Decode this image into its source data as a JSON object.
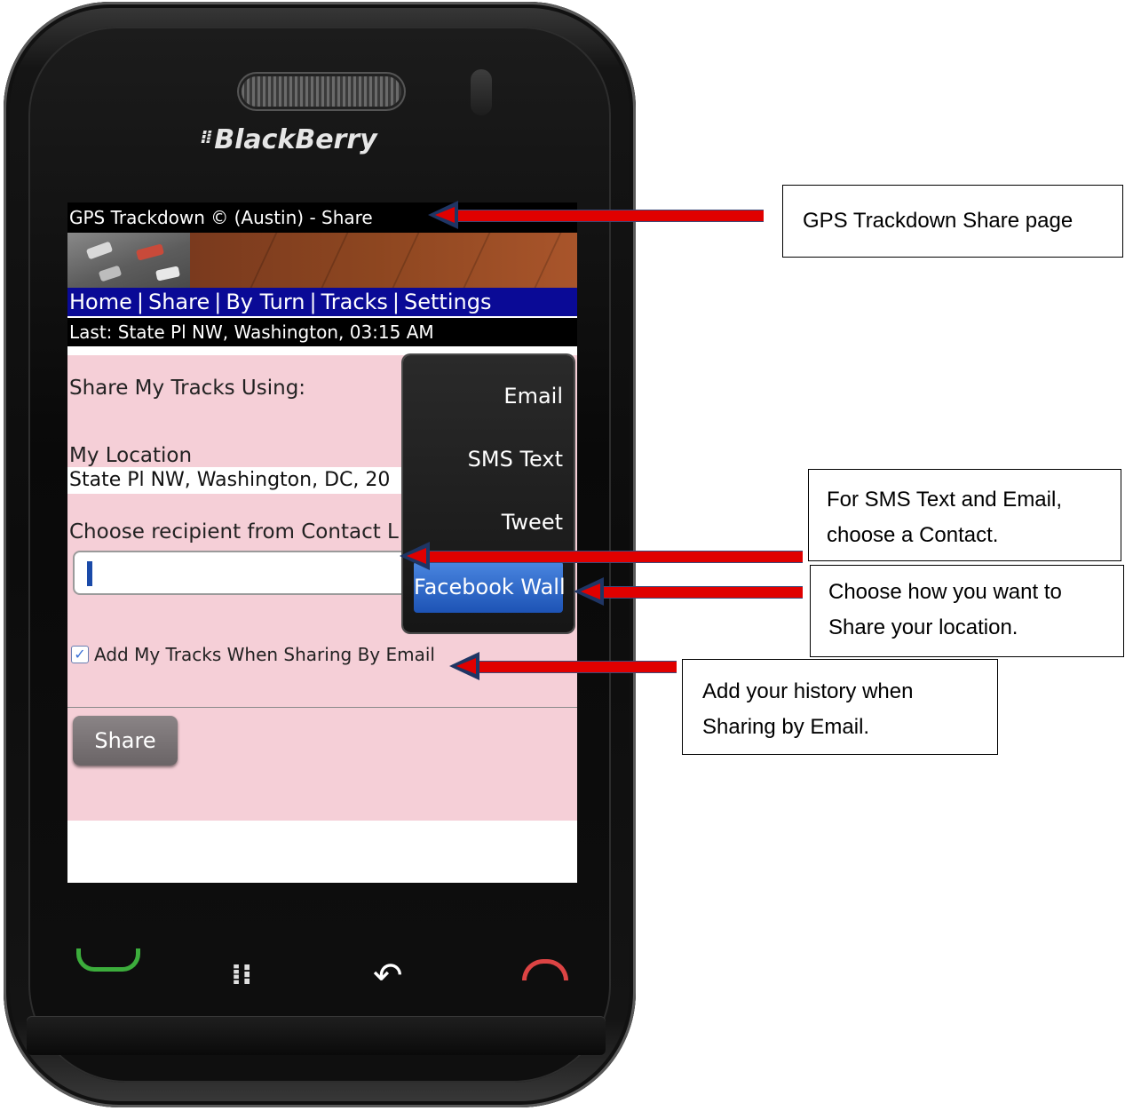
{
  "device": {
    "brand": "BlackBerry",
    "brand_dots": "⁝⁞"
  },
  "app": {
    "title": "GPS Trackdown © (Austin) - Share",
    "nav": [
      "Home",
      "Share",
      "By Turn",
      "Tracks",
      "Settings"
    ],
    "nav_separator": "|",
    "last_location": "Last: State Pl NW, Washington, 03:15 AM",
    "share_using_label": "Share My Tracks Using:",
    "my_location_label": "My Location",
    "my_location_value": "State Pl NW, Washington, DC, 20",
    "recipient_label": "Choose recipient from Contact L",
    "recipient_value": "",
    "add_tracks_checked": true,
    "add_tracks_label": "Add My Tracks When Sharing By Email",
    "share_button": "Share",
    "menu": {
      "items": [
        "Email",
        "SMS Text",
        "Tweet",
        "Facebook Wall"
      ],
      "selected": "Facebook Wall"
    }
  },
  "keys": {
    "menu_glyph": "⁞⁝",
    "back_glyph": "↶"
  },
  "callouts": {
    "share_page": "GPS Trackdown Share page",
    "contact_line1": "For SMS Text and Email,",
    "contact_line2": "choose a Contact.",
    "share_how_line1": "Choose how you want to",
    "share_how_line2": "Share your location.",
    "history_line1": "Add your history when",
    "history_line2": "Sharing by Email."
  },
  "colors": {
    "arrow": "#e00000",
    "nav_bar": "#0a0a96",
    "content_bg": "#f5cfd7",
    "menu_selected": "#1d53b5"
  }
}
